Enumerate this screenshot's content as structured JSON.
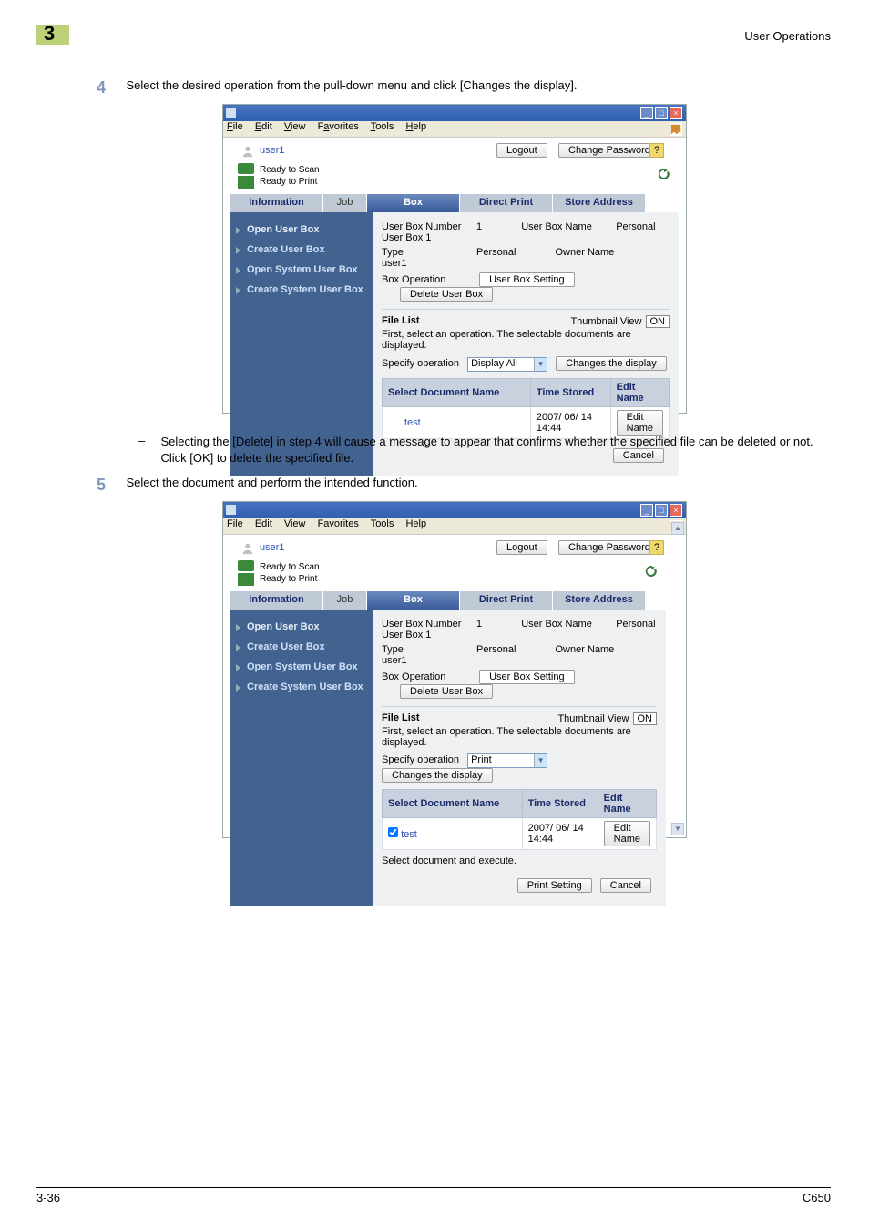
{
  "header": {
    "chapter": "3",
    "title": "User Operations"
  },
  "steps": {
    "s4": {
      "num": "4",
      "text": "Select the desired operation from the pull-down menu and click [Changes the display]."
    },
    "bullet": "Selecting the [Delete] in step 4 will cause a message to appear that confirms whether the specified file can be deleted or not. Click [OK] to delete the specified file.",
    "s5": {
      "num": "5",
      "text": "Select the document and perform the intended function."
    }
  },
  "menubar": {
    "file": "File",
    "edit": "Edit",
    "view": "View",
    "favorites": "Favorites",
    "tools": "Tools",
    "help": "Help"
  },
  "user": {
    "name": "user1",
    "logout": "Logout",
    "changepw": "Change Password",
    "help": "?"
  },
  "status": {
    "s1": "Ready to Scan",
    "s2": "Ready to Print"
  },
  "tabs": {
    "info": "Information",
    "job": "Job",
    "box": "Box",
    "direct": "Direct Print",
    "store": "Store Address"
  },
  "sidebar": {
    "items": [
      {
        "label": "Open User Box"
      },
      {
        "label": "Create User Box"
      },
      {
        "label": "Open System User Box"
      },
      {
        "label": "Create System User Box"
      }
    ]
  },
  "box": {
    "ubn_label": "User Box Number",
    "ubn": "1",
    "ubname_label": "User Box Name",
    "ubname": "Personal User Box 1",
    "type_label": "Type",
    "type": "Personal",
    "owner_label": "Owner Name",
    "owner": "user1",
    "op_label": "Box Operation",
    "ubs_btn": "User Box Setting",
    "del_btn": "Delete User Box"
  },
  "filelist": {
    "title": "File List",
    "thumb_label": "Thumbnail View",
    "thumb_on": "ON",
    "note": "First, select an operation. The selectable documents are displayed.",
    "spec_label": "Specify operation",
    "spec_val_a": "Display All",
    "spec_val_b": "Print",
    "change_btn": "Changes the display",
    "th_name": "Select Document Name",
    "th_time": "Time Stored",
    "th_edit": "Edit Name",
    "doc": "test",
    "time": "2007/ 06/ 14 14:44",
    "edit_btn": "Edit Name",
    "exec_note": "Select document and execute."
  },
  "footer": {
    "cancel": "Cancel",
    "print_setting": "Print Setting"
  },
  "page_footer": {
    "left": "3-36",
    "right": "C650"
  }
}
